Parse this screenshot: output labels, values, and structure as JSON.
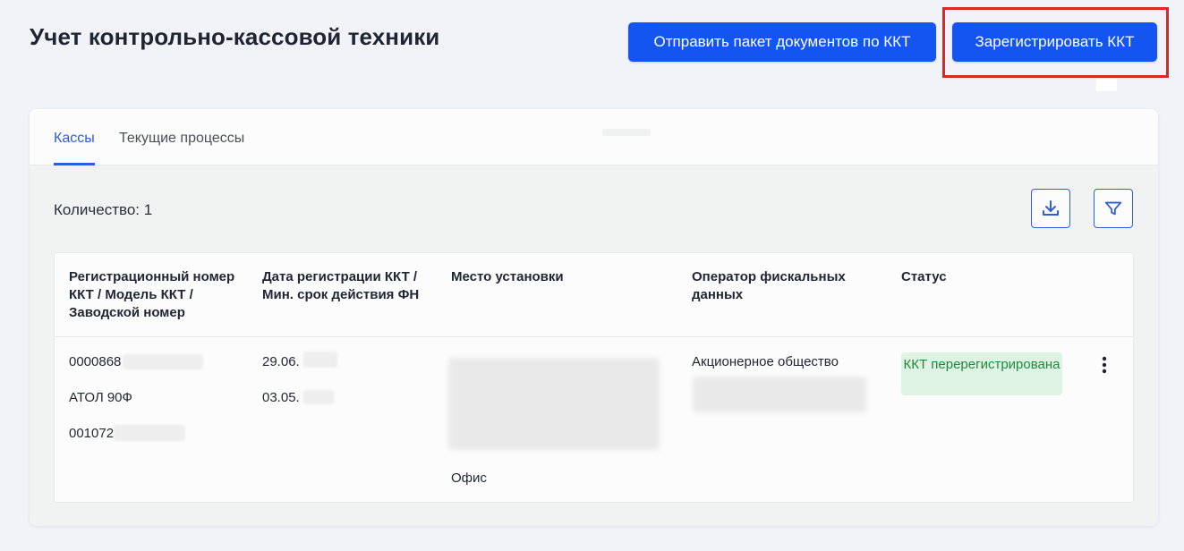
{
  "page": {
    "title": "Учет контрольно-кассовой техники"
  },
  "header": {
    "send_button_label": "Отправить пакет документов по ККТ",
    "register_button_label": "Зарегистрировать ККТ"
  },
  "tabs": [
    {
      "label": "Кассы",
      "active": true
    },
    {
      "label": "Текущие процессы",
      "active": false
    }
  ],
  "toolbar": {
    "count_text": "Количество: 1",
    "download_icon": "download-icon",
    "filter_icon": "filter-icon"
  },
  "table": {
    "columns": [
      "Регистрационный номер ККТ / Модель ККТ / Заводской номер",
      "Дата регистрации ККТ / Мин. срок действия ФН",
      "Место установки",
      "Оператор фискальных данных",
      "Статус"
    ],
    "rows": [
      {
        "reg_number": "0000868",
        "model": "АТОЛ 90Ф",
        "serial": "001072",
        "reg_date": "29.06.",
        "fn_date": "03.05.",
        "place": "Офис",
        "operator": "Акционерное общество",
        "status": "ККТ перерегистрирована"
      }
    ]
  },
  "colors": {
    "accent": "#1454f0",
    "tab_active": "#2e5fd8",
    "status_bg": "#dff3e4",
    "status_text": "#1e8a3b",
    "highlight": "#d42a2a"
  }
}
